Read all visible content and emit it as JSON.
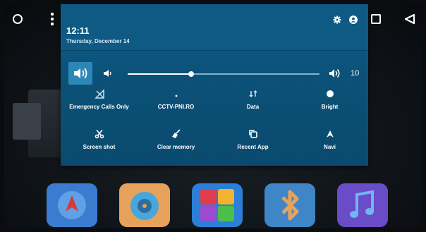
{
  "status": {
    "time": "12:11",
    "date": "Thursday, December 14"
  },
  "volume": {
    "level": 10,
    "fraction": 0.33
  },
  "quick_settings": [
    {
      "label": "Emergency Calls Only",
      "icon": "no-signal-icon"
    },
    {
      "label": "CCTV-PNI.RO",
      "icon": "wifi-icon"
    },
    {
      "label": "Data",
      "icon": "data-icon"
    },
    {
      "label": "Bright",
      "icon": "brightness-icon"
    },
    {
      "label": "Screen shot",
      "icon": "scissors-icon"
    },
    {
      "label": "Clear memory",
      "icon": "broom-icon"
    },
    {
      "label": "Recent App",
      "icon": "recent-apps-icon"
    },
    {
      "label": "Navi",
      "icon": "navigation-icon"
    }
  ],
  "dock_apps": [
    {
      "icon": "navigation-app-icon",
      "color": "#3a7cd0"
    },
    {
      "icon": "music-disc-app-icon",
      "color": "#e6a15a"
    },
    {
      "icon": "apps-grid-app-icon",
      "color": "#2b7fd6"
    },
    {
      "icon": "bluetooth-app-icon",
      "color": "#3e86c8"
    },
    {
      "icon": "music-note-app-icon",
      "color": "#6a4bc8"
    }
  ],
  "colors": {
    "shade_bg": "#0b5178",
    "accent": "#2d87b6"
  }
}
